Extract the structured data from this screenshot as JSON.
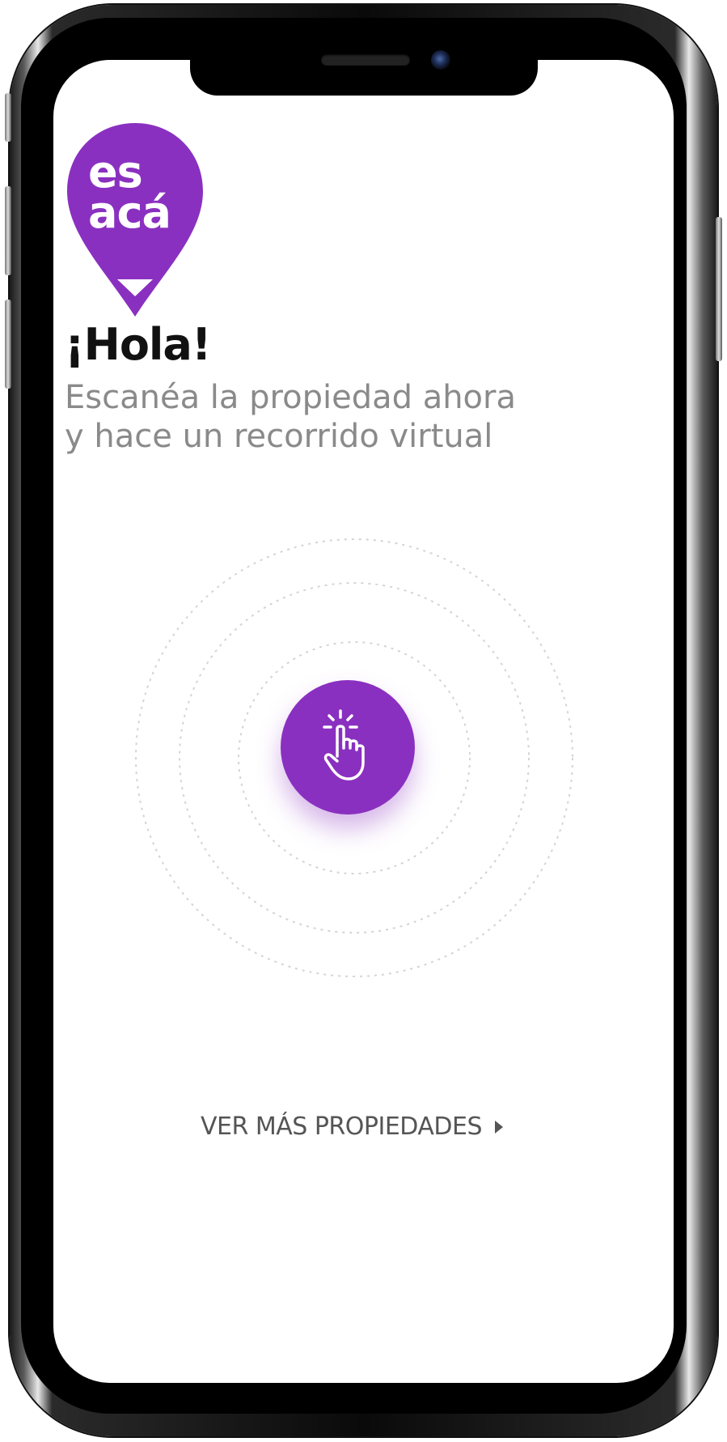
{
  "app": {
    "logo_text_line1": "es",
    "logo_text_line2": "acá",
    "brand_color": "#8a30c0"
  },
  "main": {
    "greeting": "¡Hola!",
    "subtitle_line1": "Escanéa la propiedad ahora",
    "subtitle_line2": "y hace un recorrido virtual",
    "scan_button_icon": "tap-hand-icon"
  },
  "footer": {
    "more_link_label": "VER MÁS PROPIEDADES",
    "more_link_icon": "caret-right-icon"
  }
}
